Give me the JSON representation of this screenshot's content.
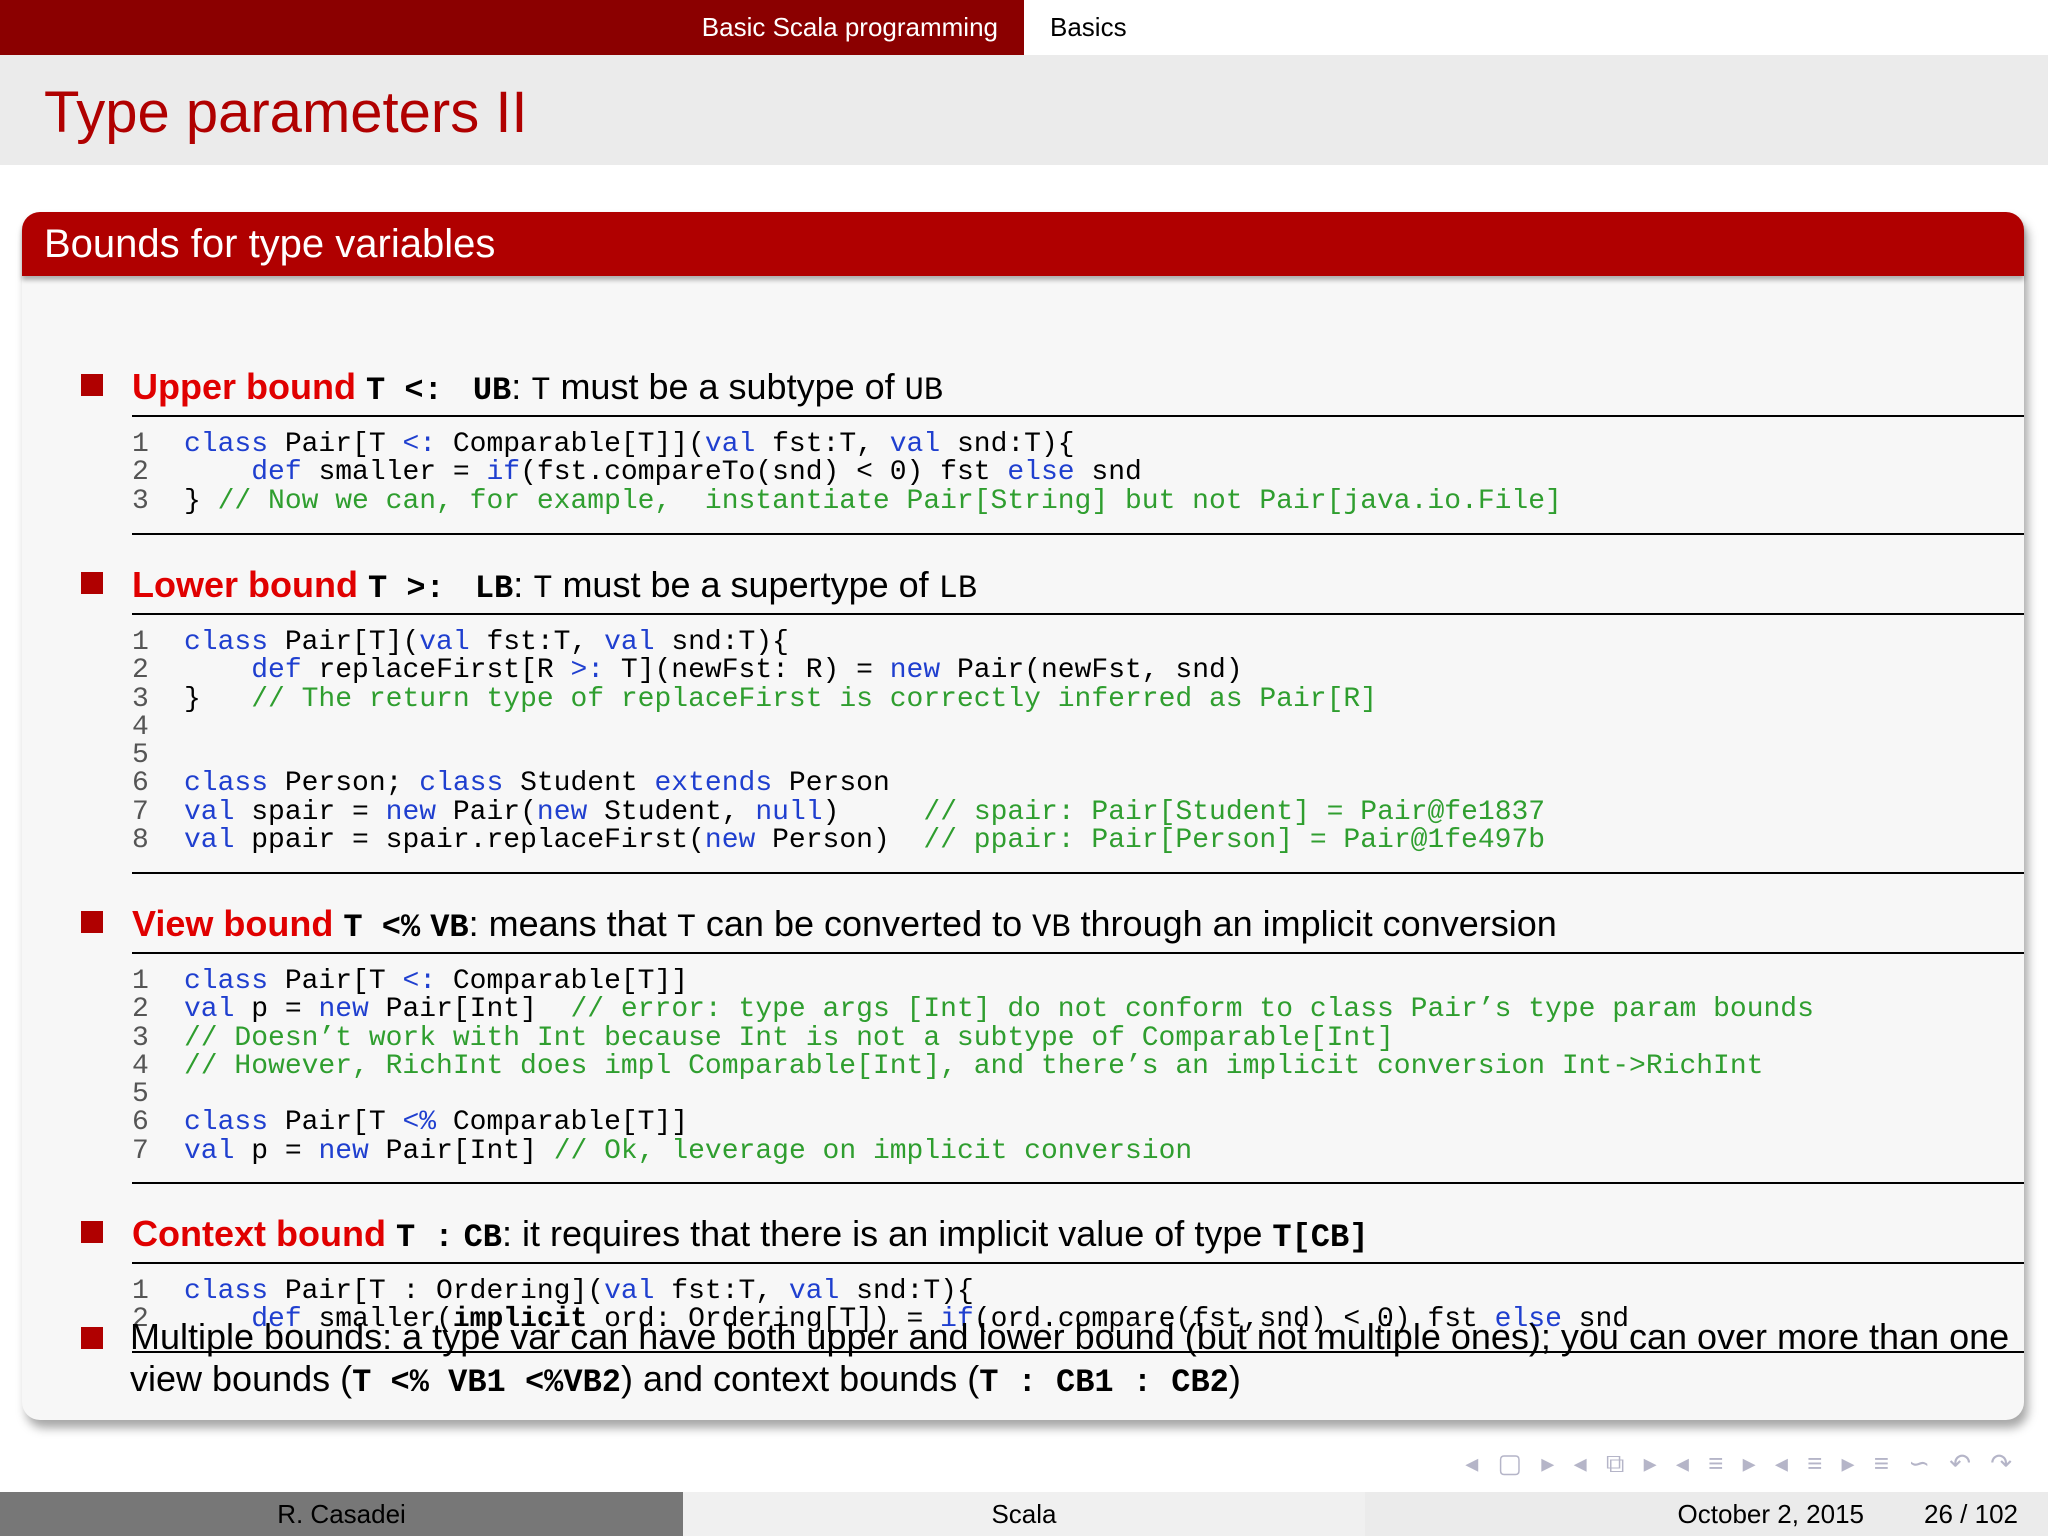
{
  "nav": {
    "section": "Basic Scala programming",
    "subsection": "Basics"
  },
  "frame": {
    "title": "Type parameters II"
  },
  "block": {
    "title": "Bounds for type variables"
  },
  "items": {
    "upper": {
      "kw": "Upper bound",
      "syn1": "T <:",
      "syn2": "UB",
      "t1": ": ",
      "m1": "T",
      "t2": " must be a subtype of ",
      "m2": "UB"
    },
    "lower": {
      "kw": "Lower bound",
      "syn1": "T >:",
      "syn2": "LB",
      "t1": ": ",
      "m1": "T",
      "t2": " must be a supertype of ",
      "m2": "LB"
    },
    "view": {
      "kw": "View bound",
      "syn1": "T <%",
      "syn2": "VB",
      "t1": ": means that ",
      "m1": "T",
      "t2": " can be converted to ",
      "m2": "VB",
      "t3": " through an implicit conversion"
    },
    "context": {
      "kw": "Context bound",
      "syn1": "T :",
      "syn2": "CB",
      "t1": ": it requires that there is an implicit value of type ",
      "m1": "T[CB]"
    },
    "multi": {
      "t1": "Multiple bounds: a type var can have both upper and lower bound (but not multiple ones); you can over more than one view bounds (",
      "c1": "T <% VB1 <%VB2",
      "t2": ") and context bounds (",
      "c2": "T : CB1 : CB2",
      "t3": ")"
    }
  },
  "code": {
    "upper": [
      {
        "n": "1",
        "s": [
          [
            "k",
            "class"
          ],
          [
            "p",
            " Pair[T "
          ],
          [
            "k",
            "<:"
          ],
          [
            "p",
            " Comparable[T]]("
          ],
          [
            "k",
            "val"
          ],
          [
            "p",
            " fst:T, "
          ],
          [
            "k",
            "val"
          ],
          [
            "p",
            " snd:T){"
          ]
        ]
      },
      {
        "n": "2",
        "s": [
          [
            "p",
            "    "
          ],
          [
            "k",
            "def"
          ],
          [
            "p",
            " smaller = "
          ],
          [
            "k",
            "if"
          ],
          [
            "p",
            "(fst.compareTo(snd) < 0) fst "
          ],
          [
            "k",
            "else"
          ],
          [
            "p",
            " snd"
          ]
        ]
      },
      {
        "n": "3",
        "s": [
          [
            "p",
            "} "
          ],
          [
            "c",
            "// Now we can, for example,  instantiate Pair[String] but not Pair[java.io.File]"
          ]
        ]
      }
    ],
    "lower": [
      {
        "n": "1",
        "s": [
          [
            "k",
            "class"
          ],
          [
            "p",
            " Pair[T]("
          ],
          [
            "k",
            "val"
          ],
          [
            "p",
            " fst:T, "
          ],
          [
            "k",
            "val"
          ],
          [
            "p",
            " snd:T){"
          ]
        ]
      },
      {
        "n": "2",
        "s": [
          [
            "p",
            "    "
          ],
          [
            "k",
            "def"
          ],
          [
            "p",
            " replaceFirst[R "
          ],
          [
            "k",
            ">:"
          ],
          [
            "p",
            " T](newFst: R) = "
          ],
          [
            "k",
            "new"
          ],
          [
            "p",
            " Pair(newFst, snd)"
          ]
        ]
      },
      {
        "n": "3",
        "s": [
          [
            "p",
            "}   "
          ],
          [
            "c",
            "// The return type of replaceFirst is correctly inferred as Pair[R]"
          ]
        ]
      },
      {
        "n": "4",
        "s": []
      },
      {
        "n": "5",
        "s": []
      },
      {
        "n": "6",
        "s": [
          [
            "k",
            "class"
          ],
          [
            "p",
            " Person; "
          ],
          [
            "k",
            "class"
          ],
          [
            "p",
            " Student "
          ],
          [
            "k",
            "extends"
          ],
          [
            "p",
            " Person"
          ]
        ]
      },
      {
        "n": "7",
        "s": [
          [
            "k",
            "val"
          ],
          [
            "p",
            " spair = "
          ],
          [
            "k",
            "new"
          ],
          [
            "p",
            " Pair("
          ],
          [
            "k",
            "new"
          ],
          [
            "p",
            " Student, "
          ],
          [
            "k",
            "null"
          ],
          [
            "p",
            ")     "
          ],
          [
            "c",
            "// spair: Pair[Student] = Pair@fe1837"
          ]
        ]
      },
      {
        "n": "8",
        "s": [
          [
            "k",
            "val"
          ],
          [
            "p",
            " ppair = spair.replaceFirst("
          ],
          [
            "k",
            "new"
          ],
          [
            "p",
            " Person)  "
          ],
          [
            "c",
            "// ppair: Pair[Person] = Pair@1fe497b"
          ]
        ]
      }
    ],
    "view": [
      {
        "n": "1",
        "s": [
          [
            "k",
            "class"
          ],
          [
            "p",
            " Pair[T "
          ],
          [
            "k",
            "<:"
          ],
          [
            "p",
            " Comparable[T]]"
          ]
        ]
      },
      {
        "n": "2",
        "s": [
          [
            "k",
            "val"
          ],
          [
            "p",
            " p = "
          ],
          [
            "k",
            "new"
          ],
          [
            "p",
            " Pair[Int]  "
          ],
          [
            "c",
            "// error: type args [Int] do not conform to class Pair’s type param bounds"
          ]
        ]
      },
      {
        "n": "3",
        "s": [
          [
            "c",
            "// Doesn’t work with Int because Int is not a subtype of Comparable[Int]"
          ]
        ]
      },
      {
        "n": "4",
        "s": [
          [
            "c",
            "// However, RichInt does impl Comparable[Int], and there’s an implicit conversion Int->RichInt"
          ]
        ]
      },
      {
        "n": "5",
        "s": []
      },
      {
        "n": "6",
        "s": [
          [
            "k",
            "class"
          ],
          [
            "p",
            " Pair[T "
          ],
          [
            "k",
            "<%"
          ],
          [
            "p",
            " Comparable[T]]"
          ]
        ]
      },
      {
        "n": "7",
        "s": [
          [
            "k",
            "val"
          ],
          [
            "p",
            " p = "
          ],
          [
            "k",
            "new"
          ],
          [
            "p",
            " Pair[Int] "
          ],
          [
            "c",
            "// Ok, leverage on implicit conversion"
          ]
        ]
      }
    ],
    "context": [
      {
        "n": "1",
        "s": [
          [
            "k",
            "class"
          ],
          [
            "p",
            " Pair[T : Ordering]("
          ],
          [
            "k",
            "val"
          ],
          [
            "p",
            " fst:T, "
          ],
          [
            "k",
            "val"
          ],
          [
            "p",
            " snd:T){"
          ]
        ]
      },
      {
        "n": "2",
        "s": [
          [
            "p",
            "    "
          ],
          [
            "k",
            "def"
          ],
          [
            "p",
            " smaller("
          ],
          [
            "b",
            "implicit"
          ],
          [
            "p",
            " ord: Ordering[T]) = "
          ],
          [
            "k",
            "if"
          ],
          [
            "p",
            "(ord.compare(fst,snd) < 0) fst "
          ],
          [
            "k",
            "else"
          ],
          [
            "p",
            " snd"
          ]
        ]
      }
    ]
  },
  "navsymbols": "◂ ▢ ▸ ◂ ⧉ ▸ ◂ ≡ ▸ ◂ ≡ ▸ ≡ ∽ ↶ ↷",
  "footer": {
    "author": "R. Casadei",
    "title": "Scala",
    "date": "October 2, 2015",
    "page": "26 / 102"
  },
  "colors": {
    "accent_dark": "#8b0000",
    "accent": "#b00000",
    "keyword": "#1f3fcf",
    "comment": "#2f9e2f"
  }
}
